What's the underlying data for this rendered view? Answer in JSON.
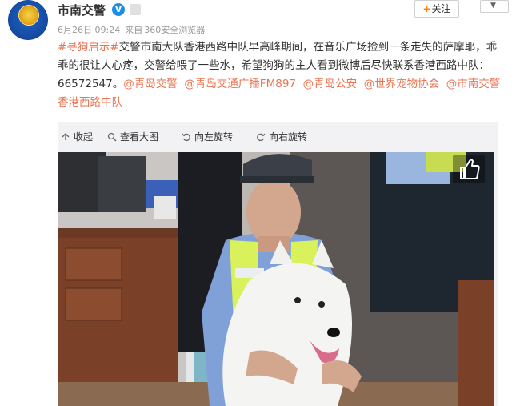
{
  "post": {
    "account_name": "市南交警",
    "verified_badge": "V",
    "meta": {
      "time": "6月26日 09:24",
      "via": "来自",
      "source": "360安全浏览器"
    },
    "follow_button": {
      "plus": "+",
      "label": "关注"
    },
    "menu_icon": "chevron-down-icon",
    "text": {
      "hashtag": "#寻狗启示#",
      "body_1": "交警市南大队香港西路中队早高峰期间，在音乐广场捡到一条走失的萨摩耶，乖乖的很让人心疼，交警给喂了一些水，希望狗狗的主人看到微博后尽快联系香港西路中队：66572547。",
      "mention_1": "@青岛交警",
      "mention_2": "@青岛交通广播FM897",
      "mention_3": "@青岛公安",
      "mention_4": "@世界宠物协会",
      "mention_5": "@市南交警香港西路中队"
    },
    "toolbar": {
      "collapse": "收起",
      "view_large": "查看大图",
      "rotate_left": "向左旋转",
      "rotate_right": "向右旋转"
    },
    "photo": {
      "like_icon": "thumbs-up-icon"
    }
  },
  "colors": {
    "link": "#eb7350",
    "meta": "#999999",
    "verified": "#1b8ee6",
    "follow_plus": "#ff8200"
  }
}
